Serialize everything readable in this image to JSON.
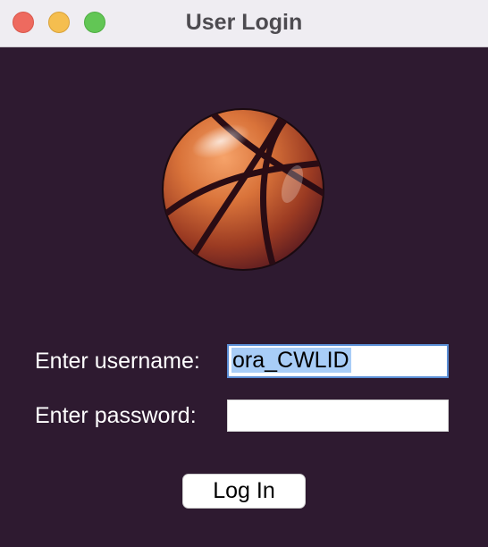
{
  "window": {
    "title": "User Login"
  },
  "logo": {
    "icon": "basketball-icon"
  },
  "form": {
    "username_label": "Enter username:",
    "username_value": "ora_CWLID",
    "password_label": "Enter password:",
    "password_value": "",
    "login_label": "Log In"
  },
  "colors": {
    "background": "#2e1a30",
    "titlebar": "#efedf2",
    "selection": "#a8cdf7",
    "focus_border": "#5b8fd6",
    "ball_orange": "#d9733a"
  }
}
